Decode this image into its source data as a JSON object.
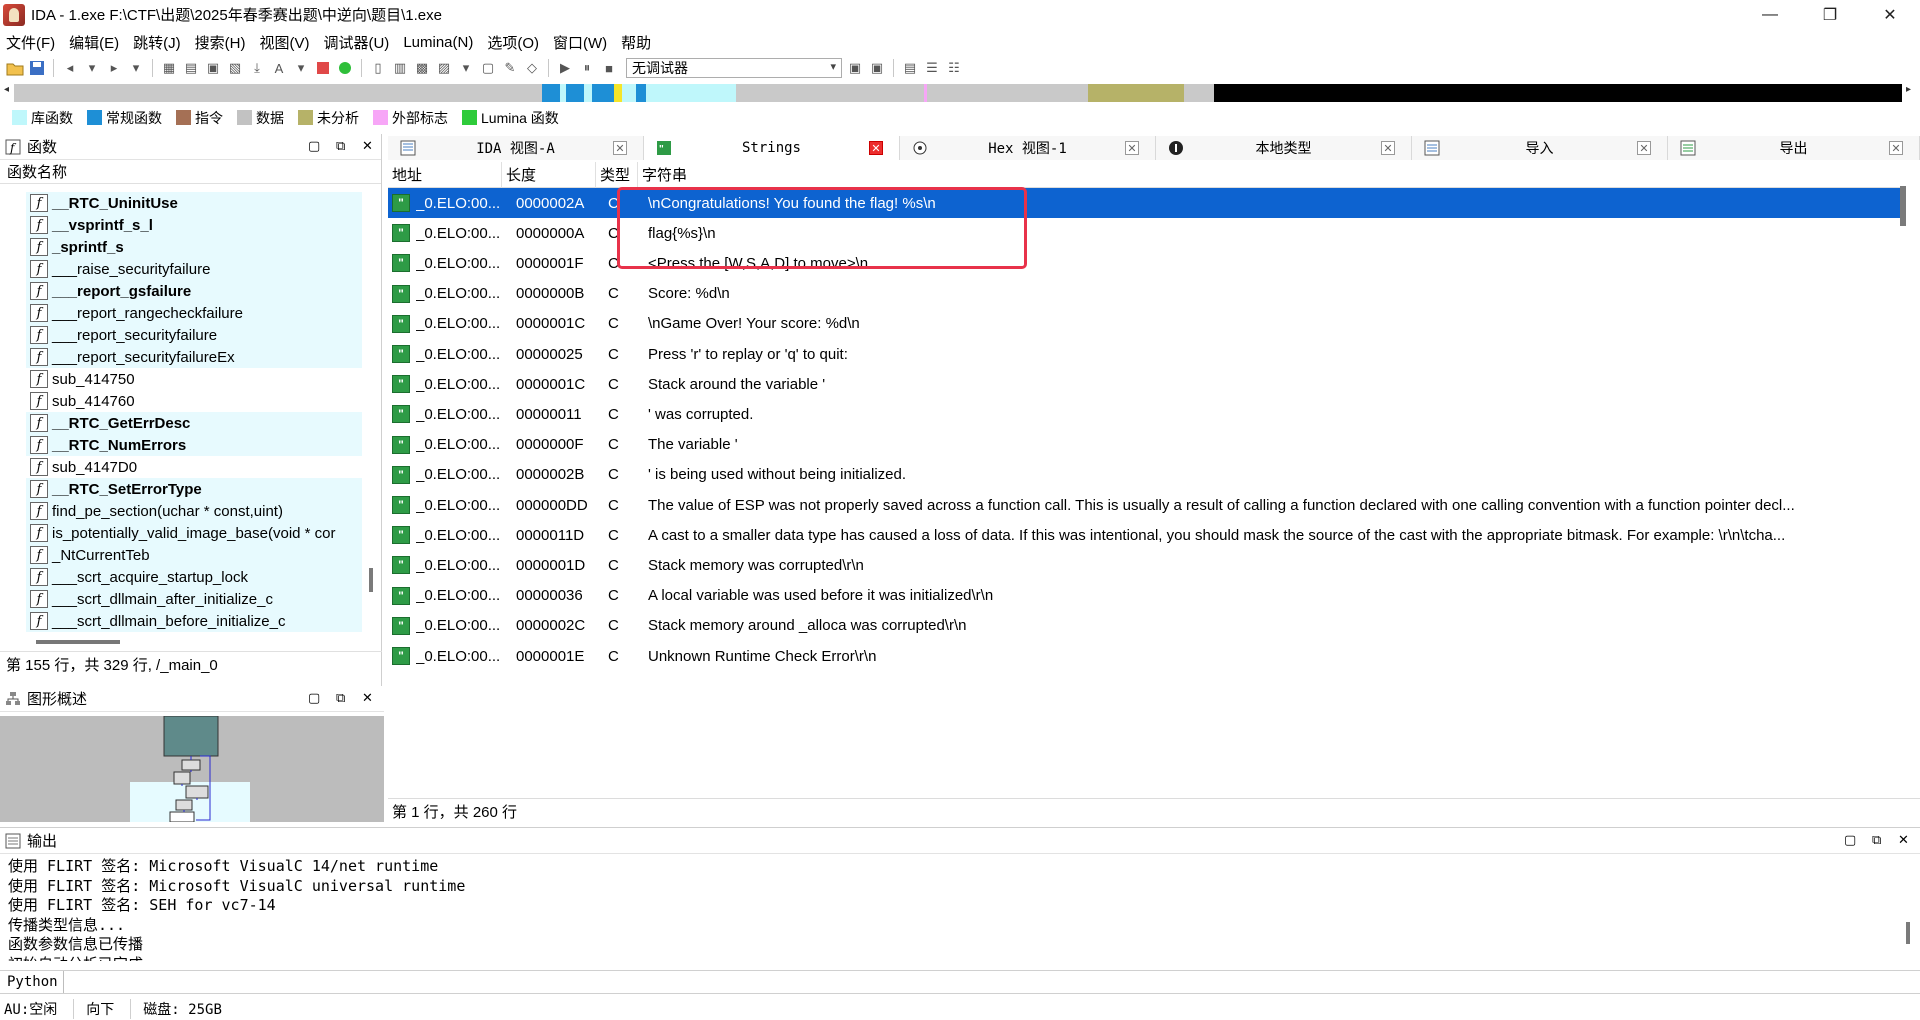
{
  "window": {
    "title": "IDA - 1.exe F:\\CTF\\出题\\2025年春季赛出题\\中逆向\\题目\\1.exe",
    "min_icon": "minimize-icon",
    "max_icon": "maximize-icon",
    "close_icon": "close-icon",
    "min_glyph": "—",
    "max_glyph": "❐",
    "close_glyph": "✕"
  },
  "menu": [
    "文件(F)",
    "编辑(E)",
    "跳转(J)",
    "搜索(H)",
    "视图(V)",
    "调试器(U)",
    "Lumina(N)",
    "选项(O)",
    "窗口(W)",
    "帮助"
  ],
  "toolbar": {
    "debugger_select": "无调试器"
  },
  "legend": [
    {
      "label": "库函数",
      "color": "#bff7fb"
    },
    {
      "label": "常规函数",
      "color": "#1e8fd6"
    },
    {
      "label": "指令",
      "color": "#a57055"
    },
    {
      "label": "数据",
      "color": "#c2c2c2"
    },
    {
      "label": "未分析",
      "color": "#b6b268"
    },
    {
      "label": "外部标志",
      "color": "#f7a6f7"
    },
    {
      "label": "Lumina 函数",
      "color": "#2ecb3a"
    }
  ],
  "functions_pane": {
    "title": "函数",
    "column_header": "函数名称",
    "items": [
      {
        "name": "__RTC_UninitUse",
        "lib": true,
        "bold": true
      },
      {
        "name": "__vsprintf_s_l",
        "lib": true,
        "bold": true
      },
      {
        "name": "_sprintf_s",
        "lib": true,
        "bold": true
      },
      {
        "name": "___raise_securityfailure",
        "lib": true,
        "bold": false
      },
      {
        "name": "___report_gsfailure",
        "lib": true,
        "bold": true
      },
      {
        "name": "___report_rangecheckfailure",
        "lib": true,
        "bold": false
      },
      {
        "name": "___report_securityfailure",
        "lib": true,
        "bold": false
      },
      {
        "name": "___report_securityfailureEx",
        "lib": true,
        "bold": false
      },
      {
        "name": "sub_414750",
        "lib": false,
        "bold": false
      },
      {
        "name": "sub_414760",
        "lib": false,
        "bold": false
      },
      {
        "name": "__RTC_GetErrDesc",
        "lib": true,
        "bold": true
      },
      {
        "name": "__RTC_NumErrors",
        "lib": true,
        "bold": true
      },
      {
        "name": "sub_4147D0",
        "lib": false,
        "bold": false
      },
      {
        "name": "__RTC_SetErrorType",
        "lib": true,
        "bold": true
      },
      {
        "name": "find_pe_section(uchar * const,uint)",
        "lib": true,
        "bold": false
      },
      {
        "name": "is_potentially_valid_image_base(void * cor",
        "lib": true,
        "bold": false
      },
      {
        "name": "_NtCurrentTeb",
        "lib": true,
        "bold": false
      },
      {
        "name": "___scrt_acquire_startup_lock",
        "lib": true,
        "bold": false
      },
      {
        "name": "___scrt_dllmain_after_initialize_c",
        "lib": true,
        "bold": false
      },
      {
        "name": "___scrt_dllmain_before_initialize_c",
        "lib": true,
        "bold": false
      }
    ],
    "status": "第 155 行，共 329 行, /_main_0"
  },
  "graph_pane": {
    "title": "图形概述"
  },
  "tabs": [
    {
      "label": "IDA 视图-A",
      "icon": "ida-view-icon",
      "active": false
    },
    {
      "label": "Strings",
      "icon": "strings-icon",
      "active": true
    },
    {
      "label": "Hex 视图-1",
      "icon": "hex-view-icon",
      "active": false
    },
    {
      "label": "本地类型",
      "icon": "local-types-icon",
      "active": false
    },
    {
      "label": "导入",
      "icon": "imports-icon",
      "active": false
    },
    {
      "label": "导出",
      "icon": "exports-icon",
      "active": false
    }
  ],
  "strings_table": {
    "columns": [
      "地址",
      "长度",
      "类型",
      "字符串"
    ],
    "rows": [
      {
        "addr": "_0.ELO:00...",
        "len": "0000002A",
        "type": "C",
        "str": "\\nCongratulations! You found the flag! %s\\n"
      },
      {
        "addr": "_0.ELO:00...",
        "len": "0000000A",
        "type": "C",
        "str": "flag{%s}\\n"
      },
      {
        "addr": "_0.ELO:00...",
        "len": "0000001F",
        "type": "C",
        "str": "<Press the [W,S,A,D] to move>\\n"
      },
      {
        "addr": "_0.ELO:00...",
        "len": "0000000B",
        "type": "C",
        "str": "Score: %d\\n"
      },
      {
        "addr": "_0.ELO:00...",
        "len": "0000001C",
        "type": "C",
        "str": "\\nGame Over! Your score: %d\\n"
      },
      {
        "addr": "_0.ELO:00...",
        "len": "00000025",
        "type": "C",
        "str": "Press 'r' to replay or 'q' to quit:"
      },
      {
        "addr": "_0.ELO:00...",
        "len": "0000001C",
        "type": "C",
        "str": "Stack around the variable '"
      },
      {
        "addr": "_0.ELO:00...",
        "len": "00000011",
        "type": "C",
        "str": "' was corrupted."
      },
      {
        "addr": "_0.ELO:00...",
        "len": "0000000F",
        "type": "C",
        "str": "The variable '"
      },
      {
        "addr": "_0.ELO:00...",
        "len": "0000002B",
        "type": "C",
        "str": "' is being used without being initialized."
      },
      {
        "addr": "_0.ELO:00...",
        "len": "000000DD",
        "type": "C",
        "str": "The value of ESP was not properly saved across a function call.  This is usually a result of calling a function declared with one calling convention with a function pointer decl..."
      },
      {
        "addr": "_0.ELO:00...",
        "len": "0000011D",
        "type": "C",
        "str": "A cast to a smaller data type has caused a loss of data.  If this was intentional, you should mask the source of the cast with the appropriate bitmask.  For example:  \\r\\n\\tcha..."
      },
      {
        "addr": "_0.ELO:00...",
        "len": "0000001D",
        "type": "C",
        "str": "Stack memory was corrupted\\r\\n"
      },
      {
        "addr": "_0.ELO:00...",
        "len": "00000036",
        "type": "C",
        "str": "A local variable was used before it was initialized\\r\\n"
      },
      {
        "addr": "_0.ELO:00...",
        "len": "0000002C",
        "type": "C",
        "str": "Stack memory around _alloca was corrupted\\r\\n"
      },
      {
        "addr": "_0.ELO:00...",
        "len": "0000001E",
        "type": "C",
        "str": "Unknown Runtime Check Error\\r\\n"
      }
    ],
    "status": "第 1 行，共 260 行"
  },
  "output_pane": {
    "title": "输出",
    "lines": [
      "使用 FLIRT 签名: Microsoft VisualC 14/net runtime",
      "使用 FLIRT 签名: Microsoft VisualC universal runtime",
      "使用 FLIRT 签名: SEH for vc7-14",
      "传播类型信息...",
      "函数参数信息已传播",
      "初始自动分析已完成."
    ]
  },
  "command_line": {
    "language": "Python"
  },
  "statusbar": {
    "state": "AU:空闲",
    "direction": "向下",
    "disk": "磁盘: 25GB"
  }
}
